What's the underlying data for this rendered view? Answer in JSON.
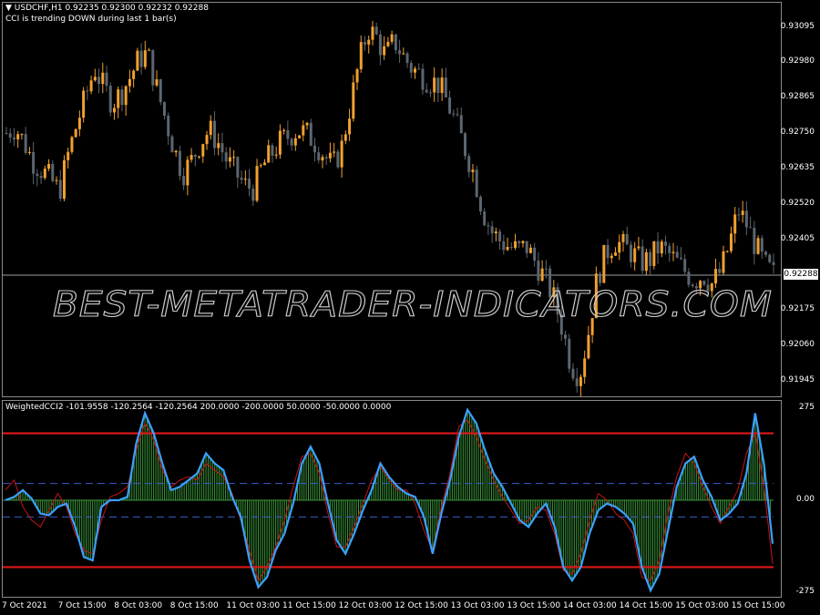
{
  "chart_window": {
    "symbol_line": "USDCHF,H1  0.92235 0.92300 0.92232 0.92288",
    "status_line": "CCI is trending DOWN during last 1 bar(s)",
    "current_price": "0.92288"
  },
  "indicator_window": {
    "header": "WeightedCCI2 -101.9558 -120.2564 -120.2564 200.0000 -200.0000 50.0000 -50.0000 0.0000"
  },
  "watermark": "BEST-METATRADER-INDICATORS.COM",
  "colors": {
    "background": "#000000",
    "bull_candle": "#f0a030",
    "bear_candle": "#5c6670",
    "cci_main": "#3ba0ff",
    "cci_signal": "#c81414",
    "level_line": "#e01818",
    "histogram": "#3c9a3c"
  },
  "chart_data": [
    {
      "type": "candlestick",
      "symbol": "USDCHF",
      "timeframe": "H1",
      "price_scale": [
        "0.93095",
        "0.92980",
        "0.92865",
        "0.92750",
        "0.92635",
        "0.92520",
        "0.92405",
        "0.92175",
        "0.92060",
        "0.91945"
      ],
      "ylim": [
        0.919,
        0.9315
      ],
      "close_trace": [
        0.9275,
        0.9277,
        0.9272,
        0.9266,
        0.9263,
        0.926,
        0.9256,
        0.9268,
        0.9278,
        0.9287,
        0.9296,
        0.929,
        0.9285,
        0.9288,
        0.9293,
        0.9299,
        0.9301,
        0.929,
        0.928,
        0.927,
        0.9262,
        0.9266,
        0.9272,
        0.9276,
        0.9272,
        0.9266,
        0.9262,
        0.9258,
        0.9257,
        0.9264,
        0.9268,
        0.9272,
        0.9274,
        0.9276,
        0.9275,
        0.9272,
        0.9268,
        0.9264,
        0.927,
        0.9284,
        0.9298,
        0.9309,
        0.9306,
        0.93,
        0.9305,
        0.93,
        0.9296,
        0.9294,
        0.9292,
        0.9291,
        0.9285,
        0.9278,
        0.927,
        0.9262,
        0.925,
        0.9243,
        0.924,
        0.9238,
        0.9237,
        0.9238,
        0.9233,
        0.9228,
        0.9222,
        0.9212,
        0.92,
        0.9196,
        0.921,
        0.9228,
        0.9236,
        0.924,
        0.9238,
        0.9236,
        0.9233,
        0.9234,
        0.9238,
        0.9236,
        0.9233,
        0.923,
        0.9227,
        0.9229,
        0.9226,
        0.923,
        0.9239,
        0.925,
        0.9245,
        0.9238,
        0.9232,
        0.9229
      ],
      "current_price": 0.92288
    },
    {
      "type": "line",
      "name": "WeightedCCI2",
      "levels": [
        200,
        -200,
        50,
        -50,
        0
      ],
      "y_scale": [
        "275",
        "0.00",
        "-275"
      ],
      "ylim": [
        -275,
        275
      ],
      "series": [
        {
          "name": "CCI",
          "values": [
            0,
            10,
            30,
            5,
            -40,
            -45,
            -20,
            -10,
            -80,
            -170,
            -180,
            -20,
            0,
            0,
            10,
            170,
            260,
            200,
            110,
            30,
            40,
            60,
            80,
            140,
            110,
            90,
            10,
            -50,
            -180,
            -260,
            -230,
            -150,
            -100,
            -10,
            110,
            160,
            110,
            -10,
            -120,
            -160,
            -100,
            -30,
            30,
            110,
            70,
            40,
            20,
            10,
            -50,
            -160,
            -40,
            60,
            190,
            270,
            230,
            150,
            80,
            40,
            -10,
            -60,
            -80,
            -40,
            -10,
            -80,
            -200,
            -240,
            -200,
            -100,
            -30,
            -10,
            -20,
            -40,
            -70,
            -200,
            -270,
            -220,
            -90,
            40,
            110,
            130,
            60,
            10,
            -60,
            -40,
            -10,
            80,
            260,
            110,
            -130
          ]
        },
        {
          "name": "Signal",
          "values": [
            30,
            60,
            -20,
            -60,
            -80,
            -30,
            20,
            -20,
            -100,
            -150,
            -160,
            -60,
            10,
            20,
            40,
            150,
            230,
            180,
            90,
            40,
            60,
            70,
            60,
            110,
            90,
            70,
            20,
            -60,
            -150,
            -240,
            -200,
            -140,
            -60,
            40,
            130,
            140,
            80,
            -40,
            -140,
            -140,
            -80,
            -10,
            60,
            100,
            60,
            30,
            30,
            -10,
            -90,
            -150,
            -20,
            80,
            220,
            240,
            190,
            120,
            60,
            10,
            -30,
            -70,
            -60,
            -20,
            -30,
            -100,
            -210,
            -220,
            -160,
            -60,
            20,
            0,
            -40,
            -60,
            -100,
            -230,
            -240,
            -180,
            -40,
            70,
            140,
            110,
            40,
            -20,
            -70,
            -20,
            30,
            140,
            200,
            40,
            -190
          ]
        }
      ]
    }
  ]
}
